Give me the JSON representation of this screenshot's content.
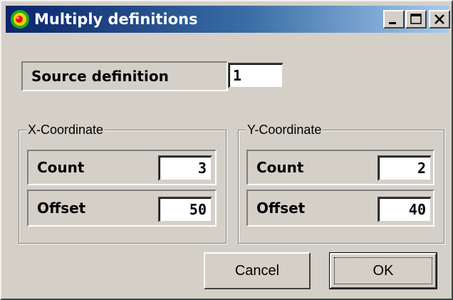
{
  "window": {
    "title": "Multiply definitions",
    "caption_buttons": [
      "minimize",
      "maximize",
      "close"
    ]
  },
  "source": {
    "label": "Source definition",
    "value": "1"
  },
  "x_group": {
    "legend": "X-Coordinate",
    "count_label": "Count",
    "count_value": "3",
    "offset_label": "Offset",
    "offset_value": "50"
  },
  "y_group": {
    "legend": "Y-Coordinate",
    "count_label": "Count",
    "count_value": "2",
    "offset_label": "Offset",
    "offset_value": "40"
  },
  "buttons": {
    "cancel": "Cancel",
    "ok": "OK"
  },
  "icons": {
    "app": "app-globe-icon",
    "minimize": "minimize-icon",
    "maximize": "maximize-icon",
    "close": "close-icon"
  },
  "colors": {
    "titlebar_start": "#0a246a",
    "titlebar_end": "#a6caf0",
    "face": "#d4d0c8"
  }
}
